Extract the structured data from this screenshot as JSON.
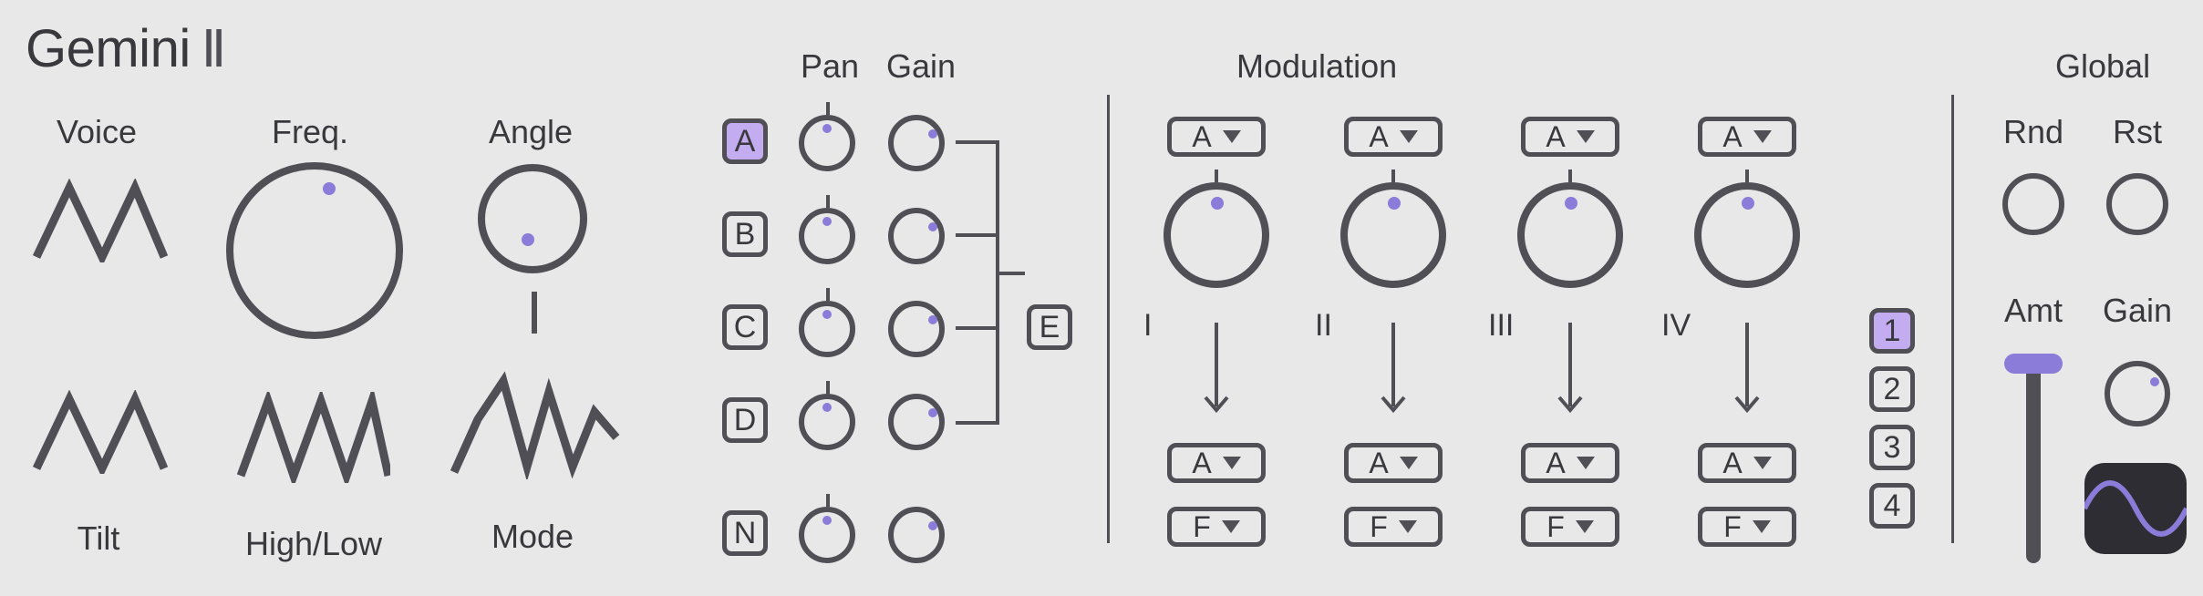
{
  "title": "Gemini",
  "symbol": "Ⅱ",
  "labels": {
    "voice": "Voice",
    "freq": "Freq.",
    "angle": "Angle",
    "tilt": "Tilt",
    "highlow": "High/Low",
    "mode": "Mode",
    "pan": "Pan",
    "gain": "Gain",
    "modulation": "Modulation",
    "global": "Global",
    "rnd": "Rnd",
    "rst": "Rst",
    "amt": "Amt",
    "gain2": "Gain",
    "e": "E"
  },
  "mixRows": [
    "A",
    "B",
    "C",
    "D",
    "N"
  ],
  "modSlots": {
    "romans": [
      "I",
      "II",
      "III",
      "IV"
    ],
    "sourceSel": [
      "A",
      "A",
      "A",
      "A"
    ],
    "destSel": [
      "A",
      "A",
      "A",
      "A"
    ],
    "paramSel": [
      "F",
      "F",
      "F",
      "F"
    ]
  },
  "pages": [
    "1",
    "2",
    "3",
    "4"
  ]
}
